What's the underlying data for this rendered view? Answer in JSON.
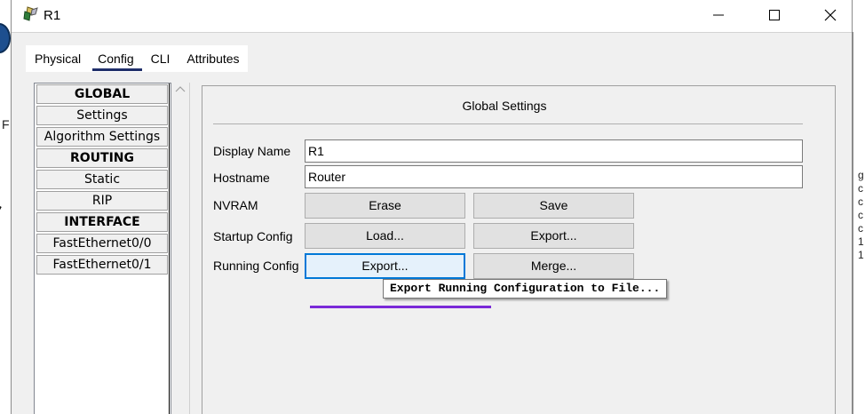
{
  "window": {
    "title": "R1",
    "app_icon": "router-config-icon",
    "controls": {
      "minimize": "minimize-icon",
      "maximize": "maximize-icon",
      "close": "close-icon"
    }
  },
  "background_app": {
    "left_letter": "F",
    "right_text": "g\nc\nc\nc\nc\n1\n1"
  },
  "tabs": [
    {
      "label": "Physical",
      "active": false
    },
    {
      "label": "Config",
      "active": true
    },
    {
      "label": "CLI",
      "active": false
    },
    {
      "label": "Attributes",
      "active": false
    }
  ],
  "sidebar": {
    "items": [
      {
        "label": "GLOBAL",
        "header": true
      },
      {
        "label": "Settings",
        "header": false
      },
      {
        "label": "Algorithm Settings",
        "header": false
      },
      {
        "label": "ROUTING",
        "header": true
      },
      {
        "label": "Static",
        "header": false
      },
      {
        "label": "RIP",
        "header": false
      },
      {
        "label": "INTERFACE",
        "header": true
      },
      {
        "label": "FastEthernet0/0",
        "header": false
      },
      {
        "label": "FastEthernet0/1",
        "header": false
      }
    ]
  },
  "main": {
    "title": "Global Settings",
    "display_name": {
      "label": "Display Name",
      "value": "R1"
    },
    "hostname": {
      "label": "Hostname",
      "value": "Router"
    },
    "nvram": {
      "label": "NVRAM",
      "erase": "Erase",
      "save": "Save"
    },
    "startup_config": {
      "label": "Startup Config",
      "load": "Load...",
      "export": "Export..."
    },
    "running_config": {
      "label": "Running Config",
      "export": "Export...",
      "merge": "Merge..."
    },
    "tooltip": "Export Running Configuration to File..."
  },
  "colors": {
    "accent_underline": "#1f2f6b",
    "hover_border": "#0078d7",
    "annotation_line": "#7a2ad8"
  }
}
